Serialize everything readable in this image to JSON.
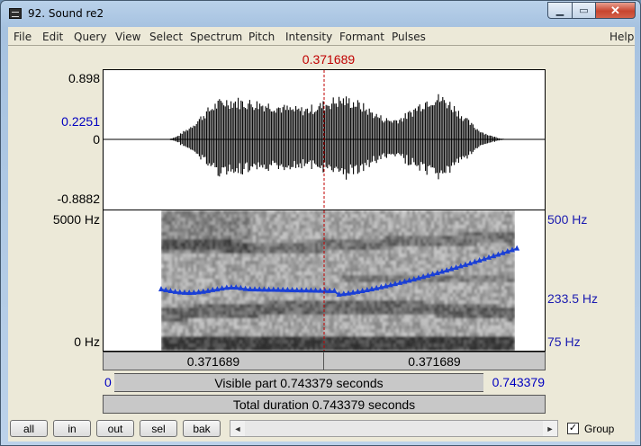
{
  "window": {
    "title": "92. Sound re2",
    "minimize_glyph": "▁",
    "maximize_glyph": "▭",
    "close_glyph": "✕"
  },
  "menu": {
    "items": [
      "File",
      "Edit",
      "Query",
      "View",
      "Select",
      "Spectrum",
      "Pitch",
      "Intensity",
      "Formant",
      "Pulses"
    ],
    "help": "Help"
  },
  "cursor": {
    "time_label": "0.371689",
    "time_fraction": 0.5
  },
  "waveform": {
    "max_label": "0.898",
    "cursor_value_label": "0.2251",
    "zero_label": "0",
    "min_label": "-0.8882"
  },
  "spectrogram": {
    "top_label": "5000 Hz",
    "bottom_label": "0 Hz"
  },
  "pitch": {
    "top_label": "500 Hz",
    "cursor_label": "233.5 Hz",
    "bottom_label": "75 Hz",
    "color": "#1a3fd6"
  },
  "bars": {
    "left_part": "0.371689",
    "right_part": "0.371689",
    "visible_start": "0",
    "visible_text": "Visible part 0.743379 seconds",
    "visible_end": "0.743379",
    "total_text": "Total duration 0.743379 seconds"
  },
  "buttons": {
    "all": "all",
    "in": "in",
    "out": "out",
    "sel": "sel",
    "bak": "bak"
  },
  "scroll": {
    "left_arrow": "◄",
    "right_arrow": "►"
  },
  "group": {
    "label": "Group",
    "checked": true,
    "check_glyph": "✓"
  }
}
